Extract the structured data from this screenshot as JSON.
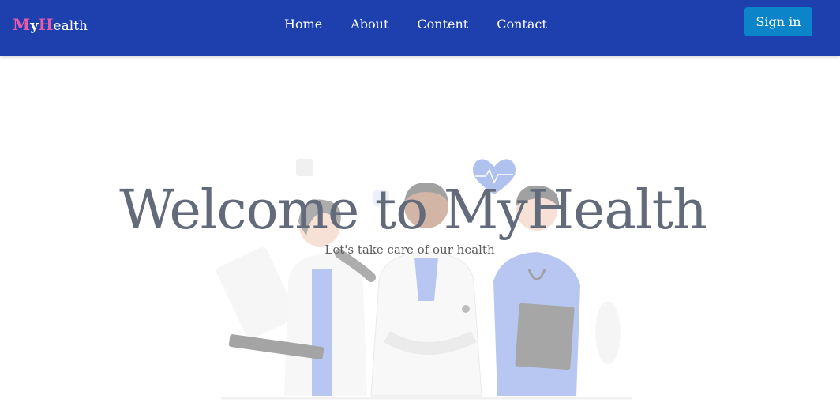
{
  "nav": {
    "logo": {
      "letter_m": "M",
      "letter_y": "y",
      "letter_h": "H",
      "rest": "ealth"
    },
    "links": [
      "Home",
      "About",
      "Content",
      "Contact"
    ],
    "signin_label": "Sign in"
  },
  "hero": {
    "title": "Welcome to MyHealth",
    "subtitle": "Let's take care of our health",
    "illustration": "doctors-team-illustration"
  },
  "colors": {
    "navbar": "#1e40af",
    "logo_accent": "#e85aa8",
    "button": "#0b84c9",
    "title": "#636a7a"
  }
}
